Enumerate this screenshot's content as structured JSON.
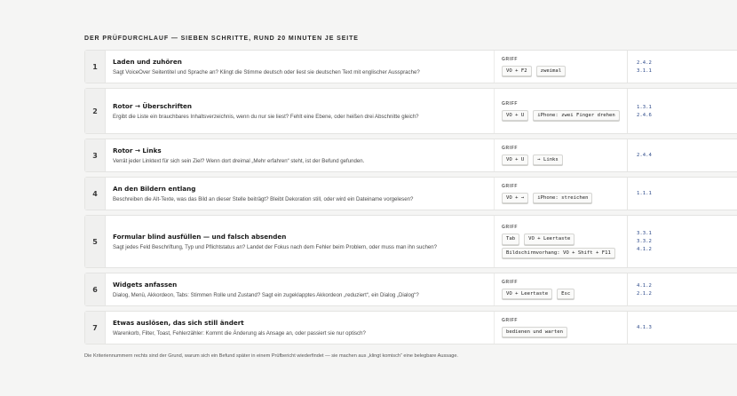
{
  "heading": "DER PRÜFDURCHLAUF — SIEBEN SCHRITTE, RUND 20 MINUTEN JE SEITE",
  "grip_label": "GRIFF",
  "rows": [
    {
      "num": "1",
      "title": "Laden und zuhören",
      "desc": "Sagt VoiceOver Seitentitel und Sprache an? Klingt die Stimme deutsch oder liest sie deutschen Text mit englischer Aussprache?",
      "keys": [
        "VO + F2",
        "zweimal"
      ],
      "criteria": [
        "2.4.2",
        "3.1.1"
      ]
    },
    {
      "num": "2",
      "title": "Rotor → Überschriften",
      "desc": "Ergibt die Liste ein brauchbares Inhaltsverzeichnis, wenn du nur sie liest? Fehlt eine Ebene, oder heißen drei Abschnitte gleich?",
      "keys": [
        "VO + U",
        "iPhone: zwei Finger drehen"
      ],
      "criteria": [
        "1.3.1",
        "2.4.6"
      ]
    },
    {
      "num": "3",
      "title": "Rotor → Links",
      "desc": "Verrät jeder Linktext für sich sein Ziel? Wenn dort dreimal „Mehr erfahren“ steht, ist der Befund gefunden.",
      "keys": [
        "VO + U",
        "→ Links"
      ],
      "criteria": [
        "2.4.4"
      ]
    },
    {
      "num": "4",
      "title": "An den Bildern entlang",
      "desc": "Beschreiben die Alt-Texte, was das Bild an dieser Stelle beiträgt? Bleibt Dekoration still, oder wird ein Dateiname vorgelesen?",
      "keys": [
        "VO + →",
        "iPhone: streichen"
      ],
      "criteria": [
        "1.1.1"
      ]
    },
    {
      "num": "5",
      "title": "Formular blind ausfüllen — und falsch absenden",
      "desc": "Sagt jedes Feld Beschriftung, Typ und Pflichtstatus an? Landet der Fokus nach dem Fehler beim Problem, oder muss man ihn suchen?",
      "keys": [
        "Tab",
        "VO + Leertaste",
        "Bildschirmvorhang: VO + Shift + F11"
      ],
      "criteria": [
        "3.3.1",
        "3.3.2",
        "4.1.2"
      ]
    },
    {
      "num": "6",
      "title": "Widgets anfassen",
      "desc": "Dialog, Menü, Akkordeon, Tabs: Stimmen Rolle und Zustand? Sagt ein zugeklapptes Akkordeon „reduziert“, ein Dialog „Dialog“?",
      "keys": [
        "VO + Leertaste",
        "Esc"
      ],
      "criteria": [
        "4.1.2",
        "2.1.2"
      ]
    },
    {
      "num": "7",
      "title": "Etwas auslösen, das sich still ändert",
      "desc": "Warenkorb, Filter, Toast, Fehlerzähler: Kommt die Änderung als Ansage an, oder passiert sie nur optisch?",
      "keys": [
        "bedienen und warten"
      ],
      "criteria": [
        "4.1.3"
      ]
    }
  ],
  "footer": "Die Kriteriennummern rechts sind der Grund, warum sich ein Befund später in einem Prüfbericht wiederfindet — sie machen aus „klingt komisch“ eine belegbare Aussage."
}
